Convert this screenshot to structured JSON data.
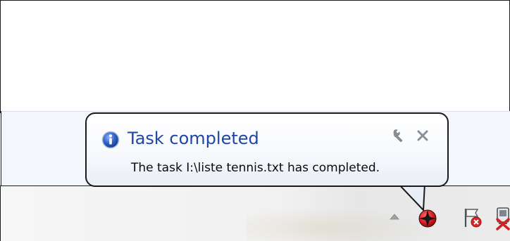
{
  "notification": {
    "title": "Task completed",
    "message": "The task I:\\liste tennis.txt has completed.",
    "icon": "info-icon",
    "options_icon": "wrench-icon",
    "close_icon": "close-icon"
  },
  "tray": {
    "icons": [
      "show-hidden-icons-arrow",
      "app-tray-icon",
      "action-center-flag-error-icon",
      "network-error-icon"
    ]
  },
  "colors": {
    "title": "#1d46a8",
    "message": "#0a0a0a",
    "balloon_border": "#1a1a1a",
    "info_icon": "#2d5fc4"
  }
}
